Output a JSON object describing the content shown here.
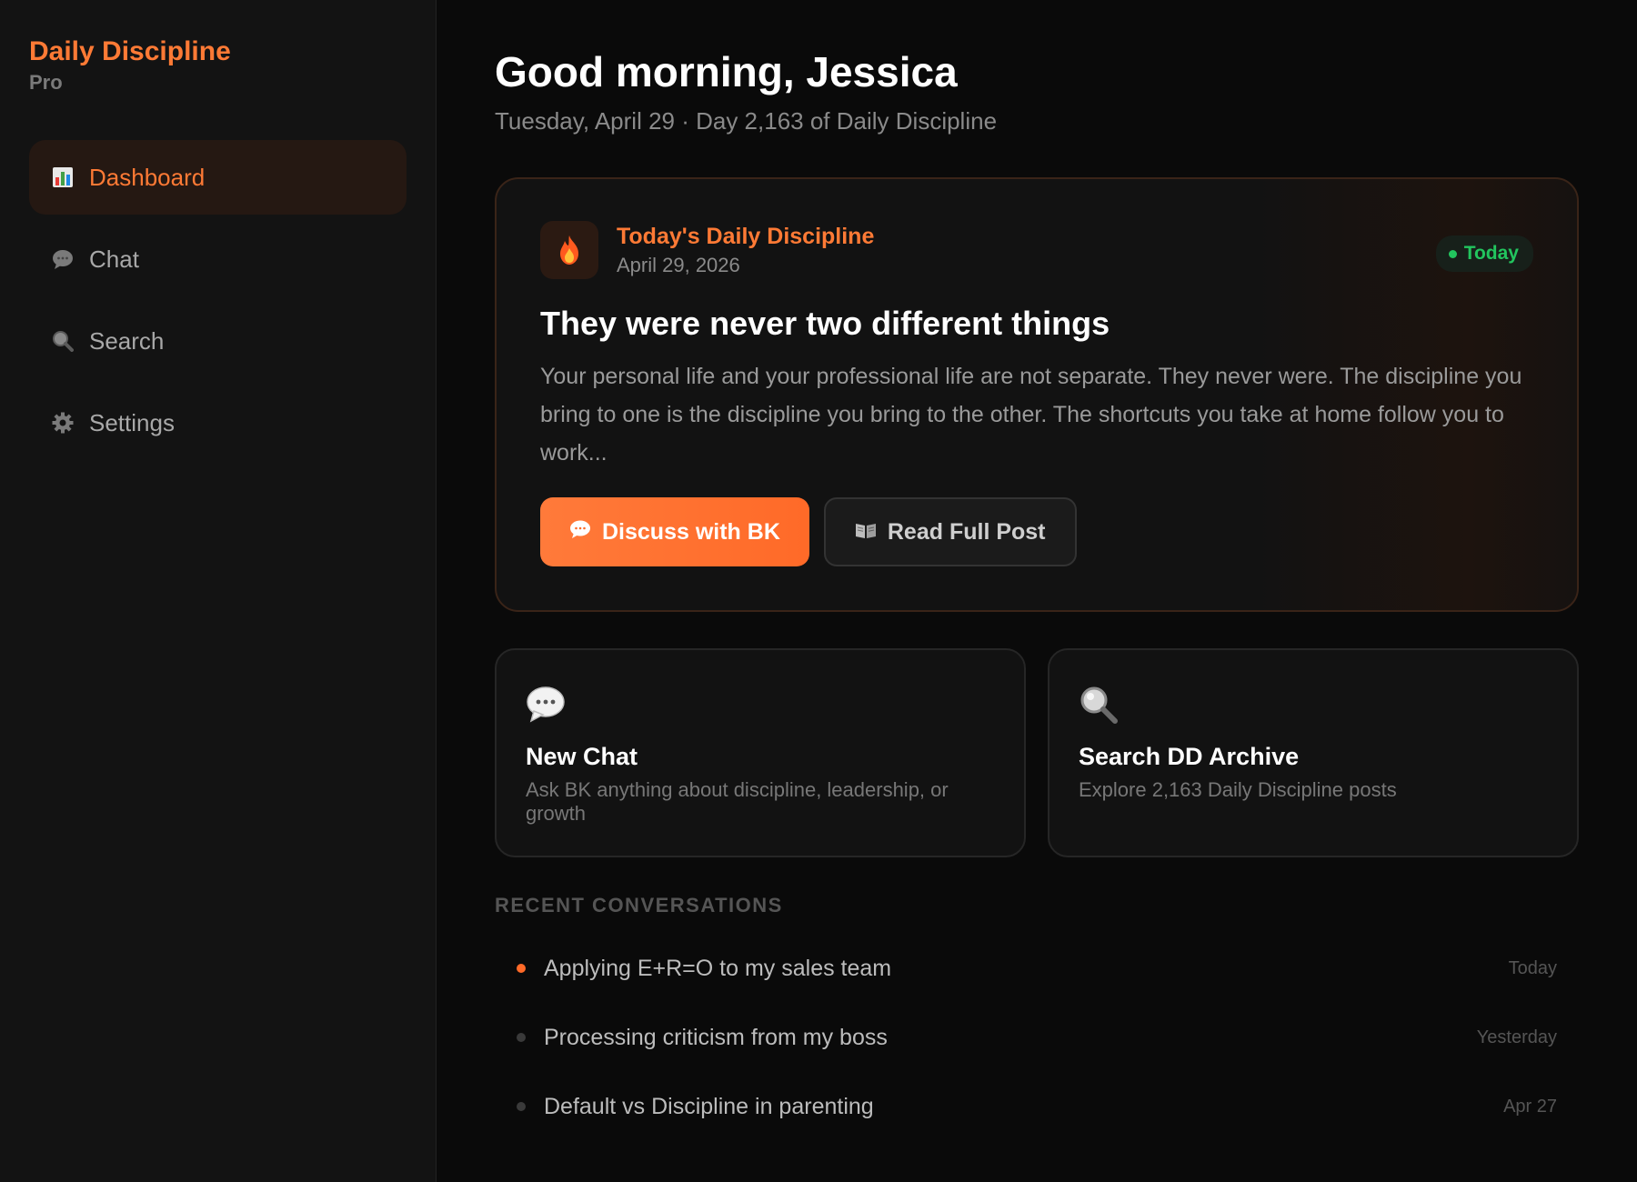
{
  "sidebar": {
    "brand": "Daily Discipline",
    "tier": "Pro",
    "items": [
      {
        "label": "Dashboard",
        "icon": "chart-icon",
        "active": true
      },
      {
        "label": "Chat",
        "icon": "speech-bubble-icon",
        "active": false
      },
      {
        "label": "Search",
        "icon": "magnifier-icon",
        "active": false
      },
      {
        "label": "Settings",
        "icon": "gear-icon",
        "active": false
      }
    ]
  },
  "header": {
    "greeting": "Good morning, Jessica",
    "subline": "Tuesday, April 29 · Day 2,163 of Daily Discipline"
  },
  "featured": {
    "label": "Today's Daily Discipline",
    "date": "April 29, 2026",
    "badge": "Today",
    "title": "They were never two different things",
    "body": "Your personal life and your professional life are not separate. They never were. The discipline you bring to one is the discipline you bring to the other. The shortcuts you take at home follow you to work...",
    "primary_button": "Discuss with BK",
    "secondary_button": "Read Full Post"
  },
  "cards": [
    {
      "title": "New Chat",
      "desc": "Ask BK anything about discipline, leadership, or growth",
      "icon": "speech-bubble-icon"
    },
    {
      "title": "Search DD Archive",
      "desc": "Explore 2,163 Daily Discipline posts",
      "icon": "magnifier-icon"
    }
  ],
  "recent": {
    "label": "RECENT CONVERSATIONS",
    "items": [
      {
        "title": "Applying E+R=O to my sales team",
        "time": "Today",
        "active": true
      },
      {
        "title": "Processing criticism from my boss",
        "time": "Yesterday",
        "active": false
      },
      {
        "title": "Default vs Discipline in parenting",
        "time": "Apr 27",
        "active": false
      }
    ]
  },
  "colors": {
    "accent": "#ff7a35",
    "success": "#22c55e",
    "background": "#0a0a0a",
    "sidebar": "#131313"
  }
}
